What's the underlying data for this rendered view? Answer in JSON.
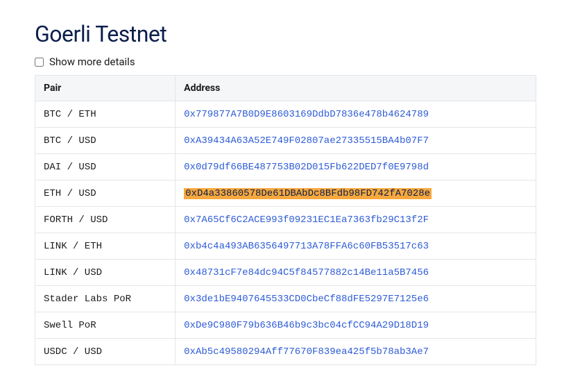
{
  "title": "Goerli Testnet",
  "show_more": {
    "label": "Show more details",
    "checked": false
  },
  "table": {
    "headers": {
      "pair": "Pair",
      "address": "Address"
    },
    "rows": [
      {
        "pair": "BTC / ETH",
        "address": "0x779877A7B0D9E8603169DdbD7836e478b4624789",
        "highlighted": false
      },
      {
        "pair": "BTC / USD",
        "address": "0xA39434A63A52E749F02807ae27335515BA4b07F7",
        "highlighted": false
      },
      {
        "pair": "DAI / USD",
        "address": "0x0d79df66BE487753B02D015Fb622DED7f0E9798d",
        "highlighted": false
      },
      {
        "pair": "ETH / USD",
        "address": "0xD4a33860578De61DBAbDc8BFdb98FD742fA7028e",
        "highlighted": true
      },
      {
        "pair": "FORTH / USD",
        "address": "0x7A65Cf6C2ACE993f09231EC1Ea7363fb29C13f2F",
        "highlighted": false
      },
      {
        "pair": "LINK / ETH",
        "address": "0xb4c4a493AB6356497713A78FFA6c60FB53517c63",
        "highlighted": false
      },
      {
        "pair": "LINK / USD",
        "address": "0x48731cF7e84dc94C5f84577882c14Be11a5B7456",
        "highlighted": false
      },
      {
        "pair": "Stader Labs PoR",
        "address": "0x3de1bE9407645533CD0CbeCf88dFE5297E7125e6",
        "highlighted": false
      },
      {
        "pair": "Swell PoR",
        "address": "0xDe9C980F79b636B46b9c3bc04cfCC94A29D18D19",
        "highlighted": false
      },
      {
        "pair": "USDC / USD",
        "address": "0xAb5c49580294Aff77670F839ea425f5b78ab3Ae7",
        "highlighted": false
      }
    ]
  }
}
